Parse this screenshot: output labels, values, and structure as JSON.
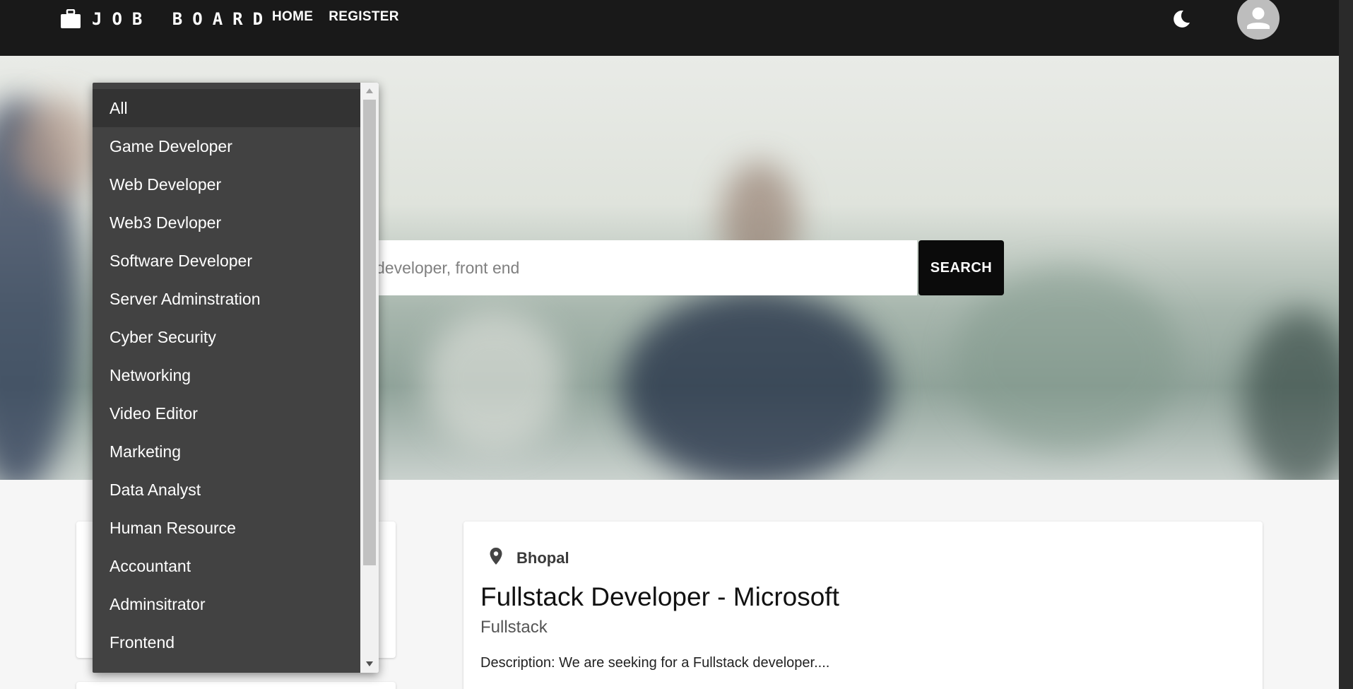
{
  "navbar": {
    "brand_text": "JOB BOARD",
    "brand_icon": "briefcase-icon",
    "links": [
      {
        "label": "HOME"
      },
      {
        "label": "REGISTER"
      }
    ],
    "theme_toggle_icon": "moon-icon",
    "avatar_icon": "user-icon"
  },
  "hero": {
    "search_placeholder": "developer, front end",
    "search_button_label": "SEARCH"
  },
  "category_dropdown": {
    "selected": "All",
    "options": [
      "All",
      "Game Developer",
      "Web Developer",
      "Web3 Devloper",
      "Software Developer",
      "Server Adminstration",
      "Cyber Security",
      "Networking",
      "Video Editor",
      "Marketing",
      "Data Analyst",
      "Human Resource",
      "Accountant",
      "Adminsitrator",
      "Frontend"
    ]
  },
  "job_card": {
    "location_icon": "location-pin-icon",
    "location": "Bhopal",
    "title": "Fullstack Developer - Microsoft",
    "category": "Fullstack",
    "description": "Description: We are seeking for a Fullstack developer...."
  },
  "colors": {
    "navbar_bg": "#191919",
    "dropdown_bg": "#424242",
    "search_button_bg": "#0b0b0b",
    "page_bg": "#f6f6f6"
  }
}
